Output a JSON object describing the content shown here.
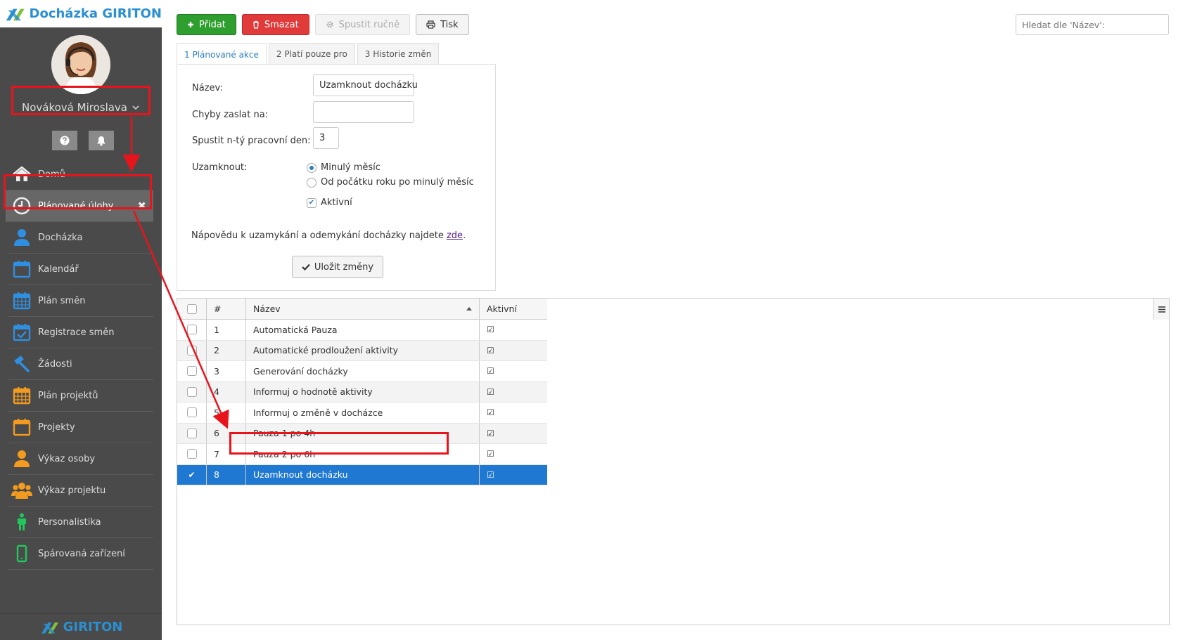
{
  "app": {
    "title": "Docházka GIRITON",
    "footer_brand": "GIRITON"
  },
  "user": {
    "name": "Nováková Miroslava"
  },
  "sidebar": {
    "items": [
      {
        "label": "Domů",
        "icon": "home-icon",
        "color": "#eeeeee"
      },
      {
        "label": "Plánované úlohy",
        "icon": "clock-icon",
        "color": "#eeeeee",
        "active": true
      },
      {
        "label": "Docházka",
        "icon": "user-icon",
        "color": "#2f8fe0"
      },
      {
        "label": "Kalendář",
        "icon": "calendar-icon",
        "color": "#2f8fe0"
      },
      {
        "label": "Plán směn",
        "icon": "calendar-grid-icon",
        "color": "#2f8fe0"
      },
      {
        "label": "Registrace směn",
        "icon": "calendar-check-icon",
        "color": "#2f8fe0"
      },
      {
        "label": "Žádosti",
        "icon": "gavel-icon",
        "color": "#2f8fe0"
      },
      {
        "label": "Plán projektů",
        "icon": "calendar-grid-icon",
        "color": "#f29b1e"
      },
      {
        "label": "Projekty",
        "icon": "calendar-icon",
        "color": "#f29b1e"
      },
      {
        "label": "Výkaz osoby",
        "icon": "user-icon",
        "color": "#f29b1e"
      },
      {
        "label": "Výkaz projektu",
        "icon": "users-icon",
        "color": "#f29b1e"
      },
      {
        "label": "Personalistika",
        "icon": "person-icon",
        "color": "#22c55e"
      },
      {
        "label": "Spárovaná zařízení",
        "icon": "mobile-icon",
        "color": "#22c55e"
      }
    ]
  },
  "toolbar": {
    "add_label": "Přidat",
    "delete_label": "Smazat",
    "run_label": "Spustit ručně",
    "print_label": "Tisk"
  },
  "search": {
    "placeholder": "Hledat dle 'Název':"
  },
  "tabs": [
    {
      "label": "1 Plánované akce"
    },
    {
      "label": "2 Platí pouze pro"
    },
    {
      "label": "3 Historie změn"
    }
  ],
  "form": {
    "name_label": "Název:",
    "name_value": "Uzamknout docházku",
    "errors_label": "Chyby zaslat na:",
    "errors_value": "",
    "day_label": "Spustit n-tý pracovní den:",
    "day_value": "3",
    "lock_label": "Uzamknout:",
    "lock_option1": "Minulý měsíc",
    "lock_option2": "Od počátku roku po minulý měsíc",
    "active_label": "Aktivní",
    "help_text": "Nápovědu k uzamykání a odemykání docházky najdete ",
    "help_link": "zde",
    "help_end": ".",
    "save_label": "Uložit změny"
  },
  "grid": {
    "headers": {
      "num": "#",
      "name": "Název",
      "active": "Aktivní"
    },
    "rows": [
      {
        "num": "1",
        "name": "Automatická Pauza"
      },
      {
        "num": "2",
        "name": "Automatické prodloužení aktivity"
      },
      {
        "num": "3",
        "name": "Generování docházky"
      },
      {
        "num": "4",
        "name": "Informuj o hodnotě aktivity"
      },
      {
        "num": "5",
        "name": "Informuj o změně v docházce"
      },
      {
        "num": "6",
        "name": "Pauza 1 po 4h"
      },
      {
        "num": "7",
        "name": "Pauza 2 po 6h"
      },
      {
        "num": "8",
        "name": "Uzamknout docházku",
        "selected": true
      }
    ]
  },
  "colors": {
    "accent": "#2b7ec1",
    "highlight": "#e8141c",
    "selected_row": "#1f78d1"
  }
}
